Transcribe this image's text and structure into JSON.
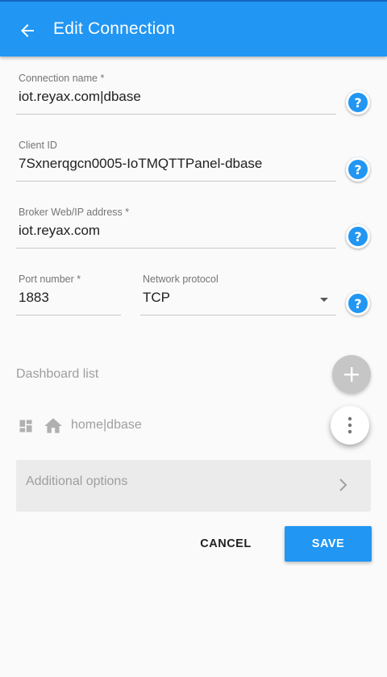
{
  "appbar": {
    "title": "Edit Connection",
    "back_icon": "arrow-left-icon",
    "color": "#2196f3"
  },
  "form": {
    "connection_name": {
      "label": "Connection name *",
      "value": "iot.reyax.com|dbase"
    },
    "client_id": {
      "label": "Client ID",
      "value": "7Sxnerqgcn0005-IoTMQTTPanel-dbase"
    },
    "broker_address": {
      "label": "Broker Web/IP address *",
      "value": "iot.reyax.com"
    },
    "port": {
      "label": "Port number *",
      "value": "1883"
    },
    "protocol": {
      "label": "Network protocol",
      "value": "TCP"
    },
    "help_symbol": "?"
  },
  "dashboard": {
    "title": "Dashboard list",
    "add_icon": "plus-icon",
    "items": [
      {
        "label": "home|dbase",
        "icon": "home-icon"
      }
    ]
  },
  "additional": {
    "label": "Additional options"
  },
  "actions": {
    "cancel_label": "CANCEL",
    "save_label": "SAVE"
  }
}
